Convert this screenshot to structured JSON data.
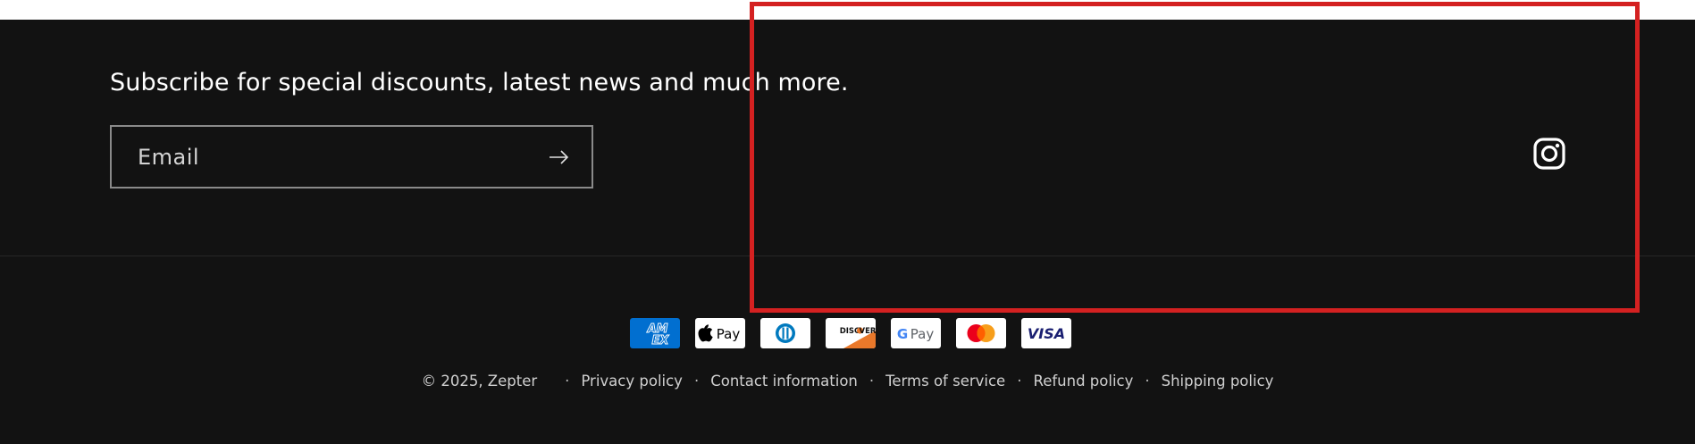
{
  "newsletter": {
    "heading": "Subscribe for special discounts, latest news and much more.",
    "email_placeholder": "Email",
    "submit_icon": "arrow-right-icon"
  },
  "social": {
    "instagram_icon": "instagram-icon"
  },
  "payment_methods": [
    "American Express",
    "Apple Pay",
    "Diners Club",
    "Discover",
    "Google Pay",
    "Mastercard",
    "Visa"
  ],
  "legal": {
    "copyright": "© 2025, Zepter",
    "links": [
      "Privacy policy",
      "Contact information",
      "Terms of service",
      "Refund policy",
      "Shipping policy"
    ],
    "separator": "·"
  },
  "colors": {
    "footer_bg": "#121212",
    "highlight": "#d42121",
    "amex_blue": "#016fd0",
    "visa_blue": "#1a1f71",
    "discover_orange": "#e9782a"
  }
}
